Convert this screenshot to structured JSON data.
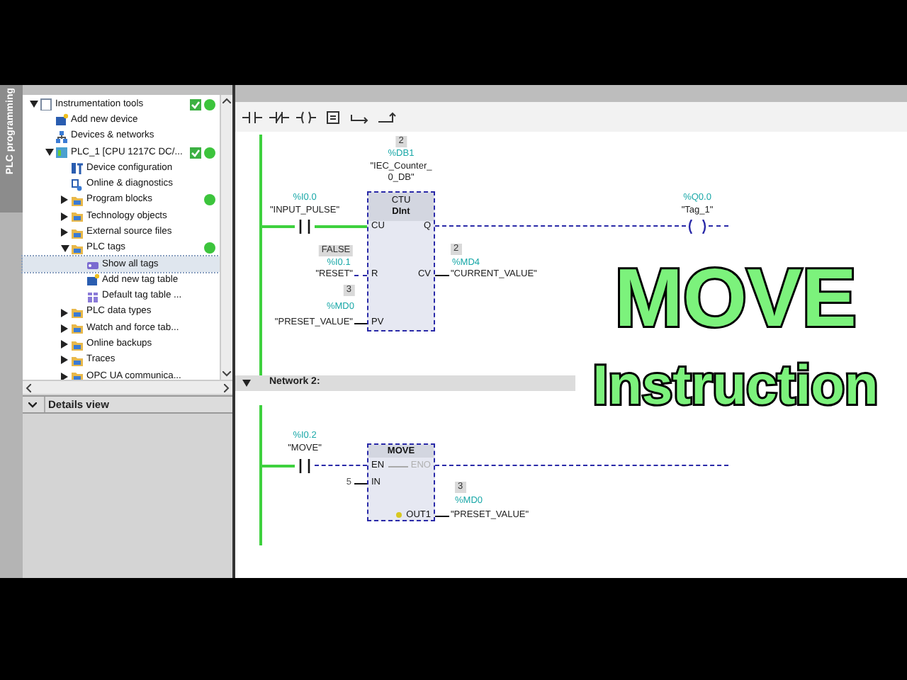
{
  "side_tab": {
    "label": "PLC programming"
  },
  "project_tree": {
    "items": [
      {
        "label": "Instrumentation tools",
        "kind": "project",
        "expanded": true,
        "selected": false,
        "check": true,
        "online": true,
        "children": [
          {
            "label": "Add new device",
            "kind": "add-device",
            "selected": false,
            "check": false,
            "online": false
          },
          {
            "label": "Devices & networks",
            "kind": "network",
            "selected": false,
            "check": false,
            "online": false
          },
          {
            "label": "PLC_1 [CPU 1217C DC/...",
            "kind": "plc",
            "expanded": true,
            "selected": false,
            "check": true,
            "online": true,
            "children": [
              {
                "label": "Device configuration",
                "kind": "config",
                "selected": false,
                "check": false,
                "online": false
              },
              {
                "label": "Online & diagnostics",
                "kind": "diagnostics",
                "selected": false,
                "check": false,
                "online": false
              },
              {
                "label": "Program blocks",
                "kind": "folder",
                "expanded": false,
                "selected": false,
                "check": false,
                "online": true
              },
              {
                "label": "Technology objects",
                "kind": "folder",
                "expanded": false,
                "selected": false,
                "check": false,
                "online": false
              },
              {
                "label": "External source files",
                "kind": "folder",
                "expanded": false,
                "selected": false,
                "check": false,
                "online": false
              },
              {
                "label": "PLC tags",
                "kind": "folder",
                "expanded": true,
                "selected": false,
                "check": false,
                "online": true,
                "children": [
                  {
                    "label": "Show all tags",
                    "kind": "tags",
                    "selected": true,
                    "check": false,
                    "online": false
                  },
                  {
                    "label": "Add new tag table",
                    "kind": "add-table",
                    "selected": false,
                    "check": false,
                    "online": false
                  },
                  {
                    "label": "Default tag table ...",
                    "kind": "table",
                    "selected": false,
                    "check": false,
                    "online": false
                  }
                ]
              },
              {
                "label": "PLC data types",
                "kind": "folder",
                "expanded": false,
                "selected": false,
                "check": false,
                "online": false
              },
              {
                "label": "Watch and force tab...",
                "kind": "folder",
                "expanded": false,
                "selected": false,
                "check": false,
                "online": false
              },
              {
                "label": "Online backups",
                "kind": "folder",
                "expanded": false,
                "selected": false,
                "check": false,
                "online": false
              },
              {
                "label": "Traces",
                "kind": "folder",
                "expanded": false,
                "selected": false,
                "check": false,
                "online": false
              },
              {
                "label": "OPC UA communica...",
                "kind": "folder",
                "expanded": false,
                "selected": false,
                "check": false,
                "online": false
              }
            ]
          }
        ]
      }
    ]
  },
  "details_view": {
    "title": "Details view"
  },
  "network_1": {
    "contact": {
      "address": "%I0.0",
      "tag": "\"INPUT_PULSE\"",
      "closed": true
    },
    "box": {
      "value": "2",
      "address": "%DB1",
      "instance_lines": [
        "\"IEC_Counter_",
        "0_DB\""
      ],
      "type": "CTU",
      "datatype": "DInt",
      "pin_cu": "CU",
      "pin_r": "R",
      "pin_pv": "PV",
      "pin_q": "Q",
      "pin_cv": "CV"
    },
    "reset": {
      "value": "FALSE",
      "address": "%I0.1",
      "tag": "\"RESET\""
    },
    "preset": {
      "value": "3",
      "address": "%MD0",
      "tag": "\"PRESET_VALUE\""
    },
    "current": {
      "value": "2",
      "address": "%MD4",
      "tag": "\"CURRENT_VALUE\""
    },
    "coil": {
      "address": "%Q0.0",
      "tag": "\"Tag_1\"",
      "energized": false
    }
  },
  "network_2": {
    "title": "Network 2:",
    "contact": {
      "address": "%I0.2",
      "tag": "\"MOVE\"",
      "closed": false
    },
    "box": {
      "type": "MOVE",
      "pin_en": "EN",
      "pin_eno": "ENO",
      "eno_enabled": false,
      "pin_in": "IN",
      "pin_out": "OUT1"
    },
    "in_value": "5",
    "out": {
      "value": "3",
      "address": "%MD0",
      "tag": "\"PRESET_VALUE\""
    }
  },
  "title_overlay": {
    "lines": [
      "MOVE",
      "Instruction"
    ]
  }
}
